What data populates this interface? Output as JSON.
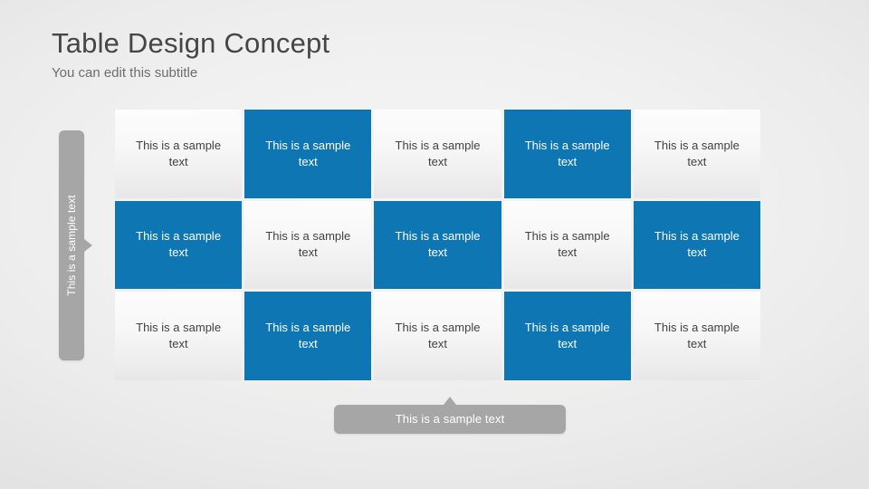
{
  "header": {
    "title": "Table Design Concept",
    "subtitle": "You can edit this subtitle"
  },
  "row_header": {
    "label": "This is a sample text"
  },
  "column_footer": {
    "label": "This is a sample text"
  },
  "colors": {
    "accent": "#0f76b4",
    "gray_bar": "#a6a6a6",
    "light_cell": "#f6f6f6",
    "background": "#eeeeee",
    "title_text": "#464646",
    "subtitle_text": "#6d6d6d",
    "cell_text": "#414141",
    "accent_text": "#ffffff"
  },
  "table": {
    "rows": 3,
    "columns": 5,
    "cells": [
      [
        {
          "text": "This is a sample text",
          "style": "light"
        },
        {
          "text": "This is a sample text",
          "style": "accent"
        },
        {
          "text": "This is a sample text",
          "style": "light"
        },
        {
          "text": "This is a sample text",
          "style": "accent"
        },
        {
          "text": "This is a sample text",
          "style": "light"
        }
      ],
      [
        {
          "text": "This is a sample text",
          "style": "accent"
        },
        {
          "text": "This is a sample text",
          "style": "light"
        },
        {
          "text": "This is a sample text",
          "style": "accent"
        },
        {
          "text": "This is a sample text",
          "style": "light"
        },
        {
          "text": "This is a sample text",
          "style": "accent"
        }
      ],
      [
        {
          "text": "This is a sample text",
          "style": "light"
        },
        {
          "text": "This is a sample text",
          "style": "accent"
        },
        {
          "text": "This is a sample text",
          "style": "light"
        },
        {
          "text": "This is a sample text",
          "style": "accent"
        },
        {
          "text": "This is a sample text",
          "style": "light"
        }
      ]
    ]
  }
}
